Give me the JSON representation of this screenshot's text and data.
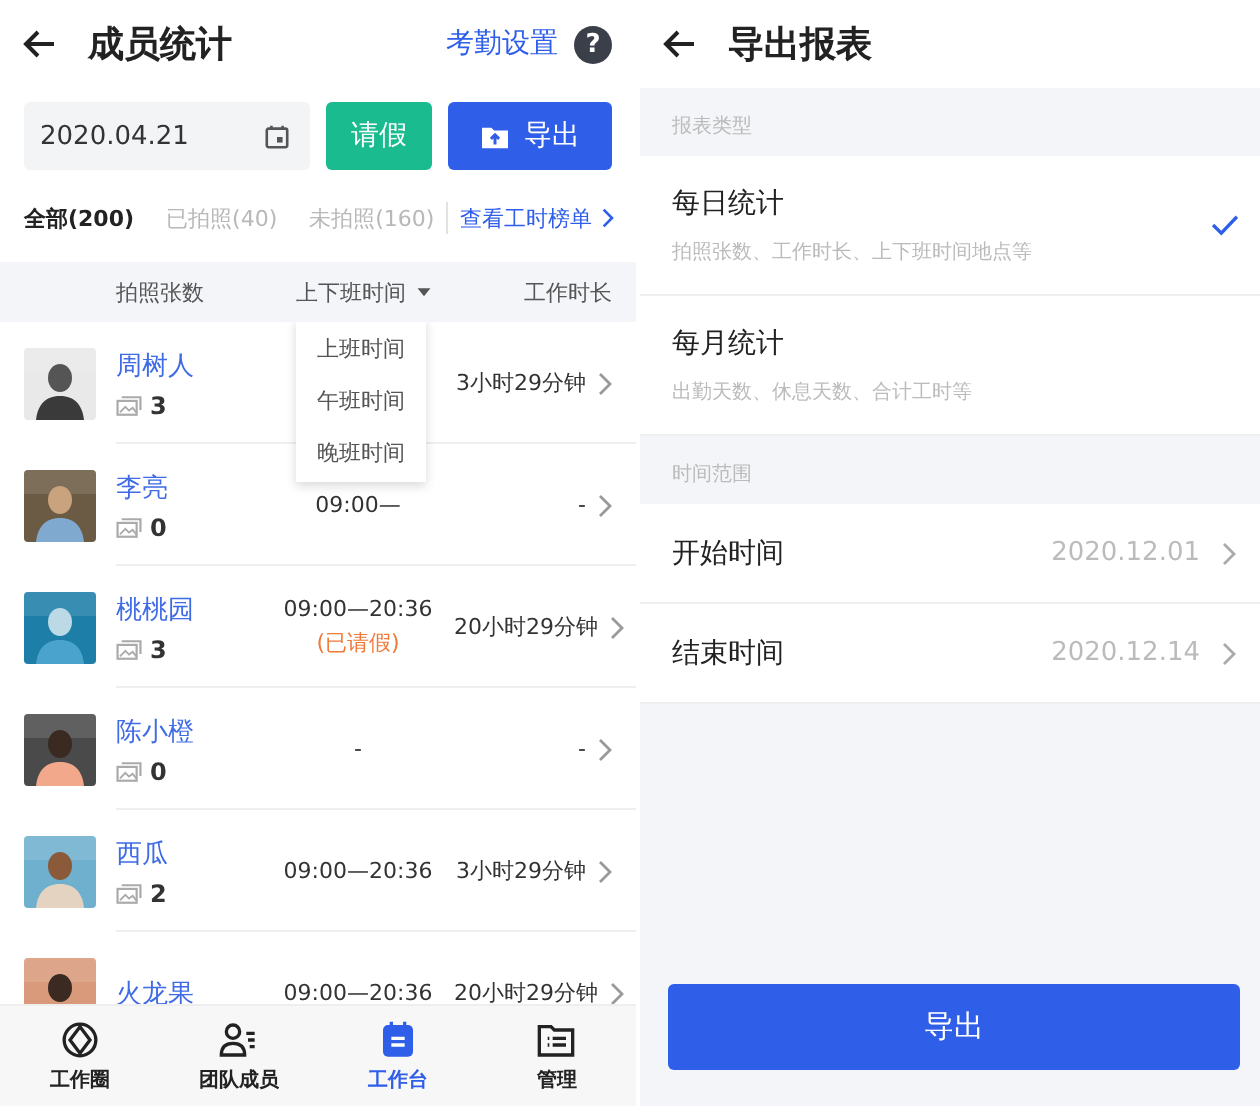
{
  "left": {
    "header": {
      "title": "成员统计",
      "action": "考勤设置",
      "help": "?"
    },
    "toolbar": {
      "date": "2020.04.21",
      "leave_button": "请假",
      "export_button": "导出"
    },
    "filters": [
      {
        "label": "全部(200)",
        "selected": true
      },
      {
        "label": "已拍照(40)",
        "selected": false
      },
      {
        "label": "未拍照(160)",
        "selected": false
      }
    ],
    "ranking_link": "查看工时榜单",
    "columns": [
      "拍照张数",
      "上下班时间",
      "工作时长"
    ],
    "time_menu": [
      "上班时间",
      "午班时间",
      "晚班时间"
    ],
    "rows": [
      {
        "name": "周树人",
        "photos": "3",
        "duration": "3小时29分钟"
      },
      {
        "name": "李亮",
        "photos": "0",
        "time": "09:00—",
        "duration": "-"
      },
      {
        "name": "桃桃园",
        "photos": "3",
        "time": "09:00—20:36",
        "note": "(已请假)",
        "duration": "20小时29分钟"
      },
      {
        "name": "陈小橙",
        "photos": "0",
        "time": "-",
        "duration": "-"
      },
      {
        "name": "西瓜",
        "photos": "2",
        "time": "09:00—20:36",
        "duration": "3小时29分钟"
      },
      {
        "name": "火龙果",
        "time": "09:00—20:36",
        "duration": "20小时29分钟"
      }
    ],
    "nav": [
      {
        "label": "工作圈",
        "selected": false
      },
      {
        "label": "团队成员",
        "selected": false
      },
      {
        "label": "工作台",
        "selected": true
      },
      {
        "label": "管理",
        "selected": false
      }
    ]
  },
  "right": {
    "header": {
      "title": "导出报表"
    },
    "sections": [
      {
        "label": "报表类型",
        "items": [
          {
            "kind": "option",
            "title": "每日统计",
            "desc": "拍照张数、工作时长、上下班时间地点等",
            "selected": true
          },
          {
            "kind": "option",
            "title": "每月统计",
            "desc": "出勤天数、休息天数、合计工时等",
            "selected": false
          }
        ]
      },
      {
        "label": "时间范围",
        "items": [
          {
            "kind": "date",
            "title": "开始时间",
            "value": "2020.12.01"
          },
          {
            "kind": "date",
            "title": "结束时间",
            "value": "2020.12.14"
          }
        ]
      }
    ],
    "button": "导出"
  }
}
